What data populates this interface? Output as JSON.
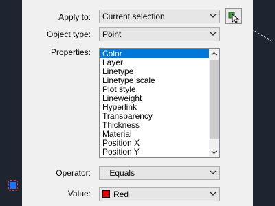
{
  "dialog": {
    "apply_to": {
      "label": "Apply to:",
      "value": "Current selection"
    },
    "object_type": {
      "label": "Object type:",
      "value": "Point"
    },
    "properties": {
      "label": "Properties:",
      "items": [
        "Color",
        "Layer",
        "Linetype",
        "Linetype scale",
        "Plot style",
        "Lineweight",
        "Hyperlink",
        "Transparency",
        "Thickness",
        "Material",
        "Position X",
        "Position Y"
      ],
      "selected": "Color"
    },
    "operator": {
      "label": "Operator:",
      "value": "= Equals"
    },
    "value": {
      "label": "Value:",
      "value": "Red",
      "swatch_color": "#e00000"
    }
  },
  "colors": {
    "selection": "#0078d7",
    "dialog_bg": "#f0f0f0",
    "backdrop": "#1f2431"
  }
}
